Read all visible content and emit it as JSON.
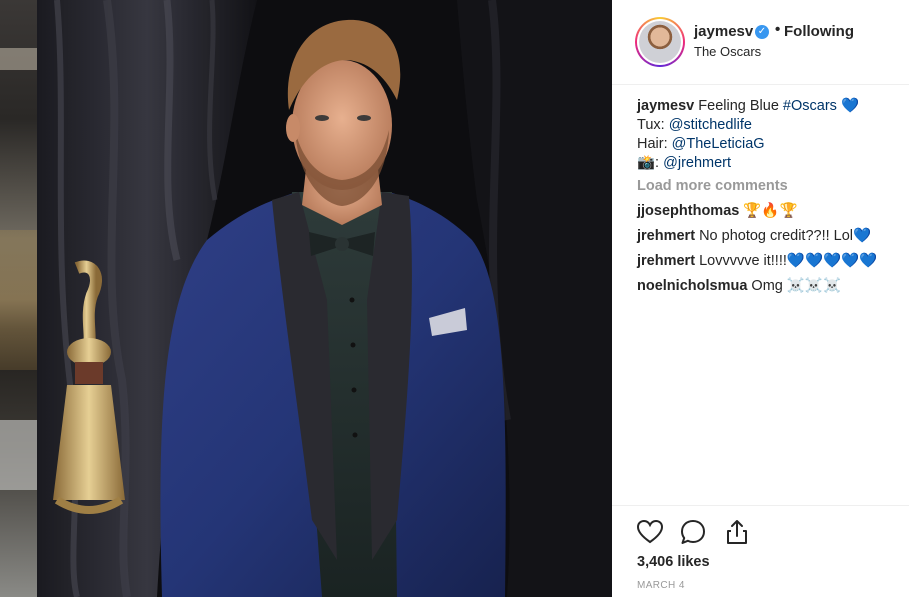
{
  "post": {
    "username": "jaymesv",
    "verified_mark": "✓",
    "separator": "•",
    "follow_state": "Following",
    "location": "The Oscars"
  },
  "caption": {
    "user": "jaymesv",
    "text": "Feeling Blue",
    "hashtag": "#Oscars",
    "emoji": "💙",
    "tux_label": "Tux:",
    "tux_handle": "@stitchedlife",
    "hair_label": "Hair:",
    "hair_handle": "@TheLeticiaG",
    "photo_label": "📸:",
    "photo_handle": "@jrehmert"
  },
  "load_more": "Load more comments",
  "comments": [
    {
      "user": "jjosephthomas",
      "text": "🏆🔥🏆"
    },
    {
      "user": "jrehmert",
      "text": "No photog credit??!! Lol💙"
    },
    {
      "user": "jrehmert",
      "text": "Lovvvvve it!!!!💙💙💙💙💙"
    },
    {
      "user": "noelnicholsmua",
      "text": "Omg ☠️☠️☠️"
    }
  ],
  "actions": {
    "like_icon": "heart-icon",
    "comment_icon": "comment-bubble-icon",
    "share_icon": "share-icon"
  },
  "likes": "3,406 likes",
  "date": "MARCH 4",
  "colors": {
    "link": "#003569",
    "verified": "#3897f0",
    "muted": "#999999",
    "text": "#262626"
  }
}
